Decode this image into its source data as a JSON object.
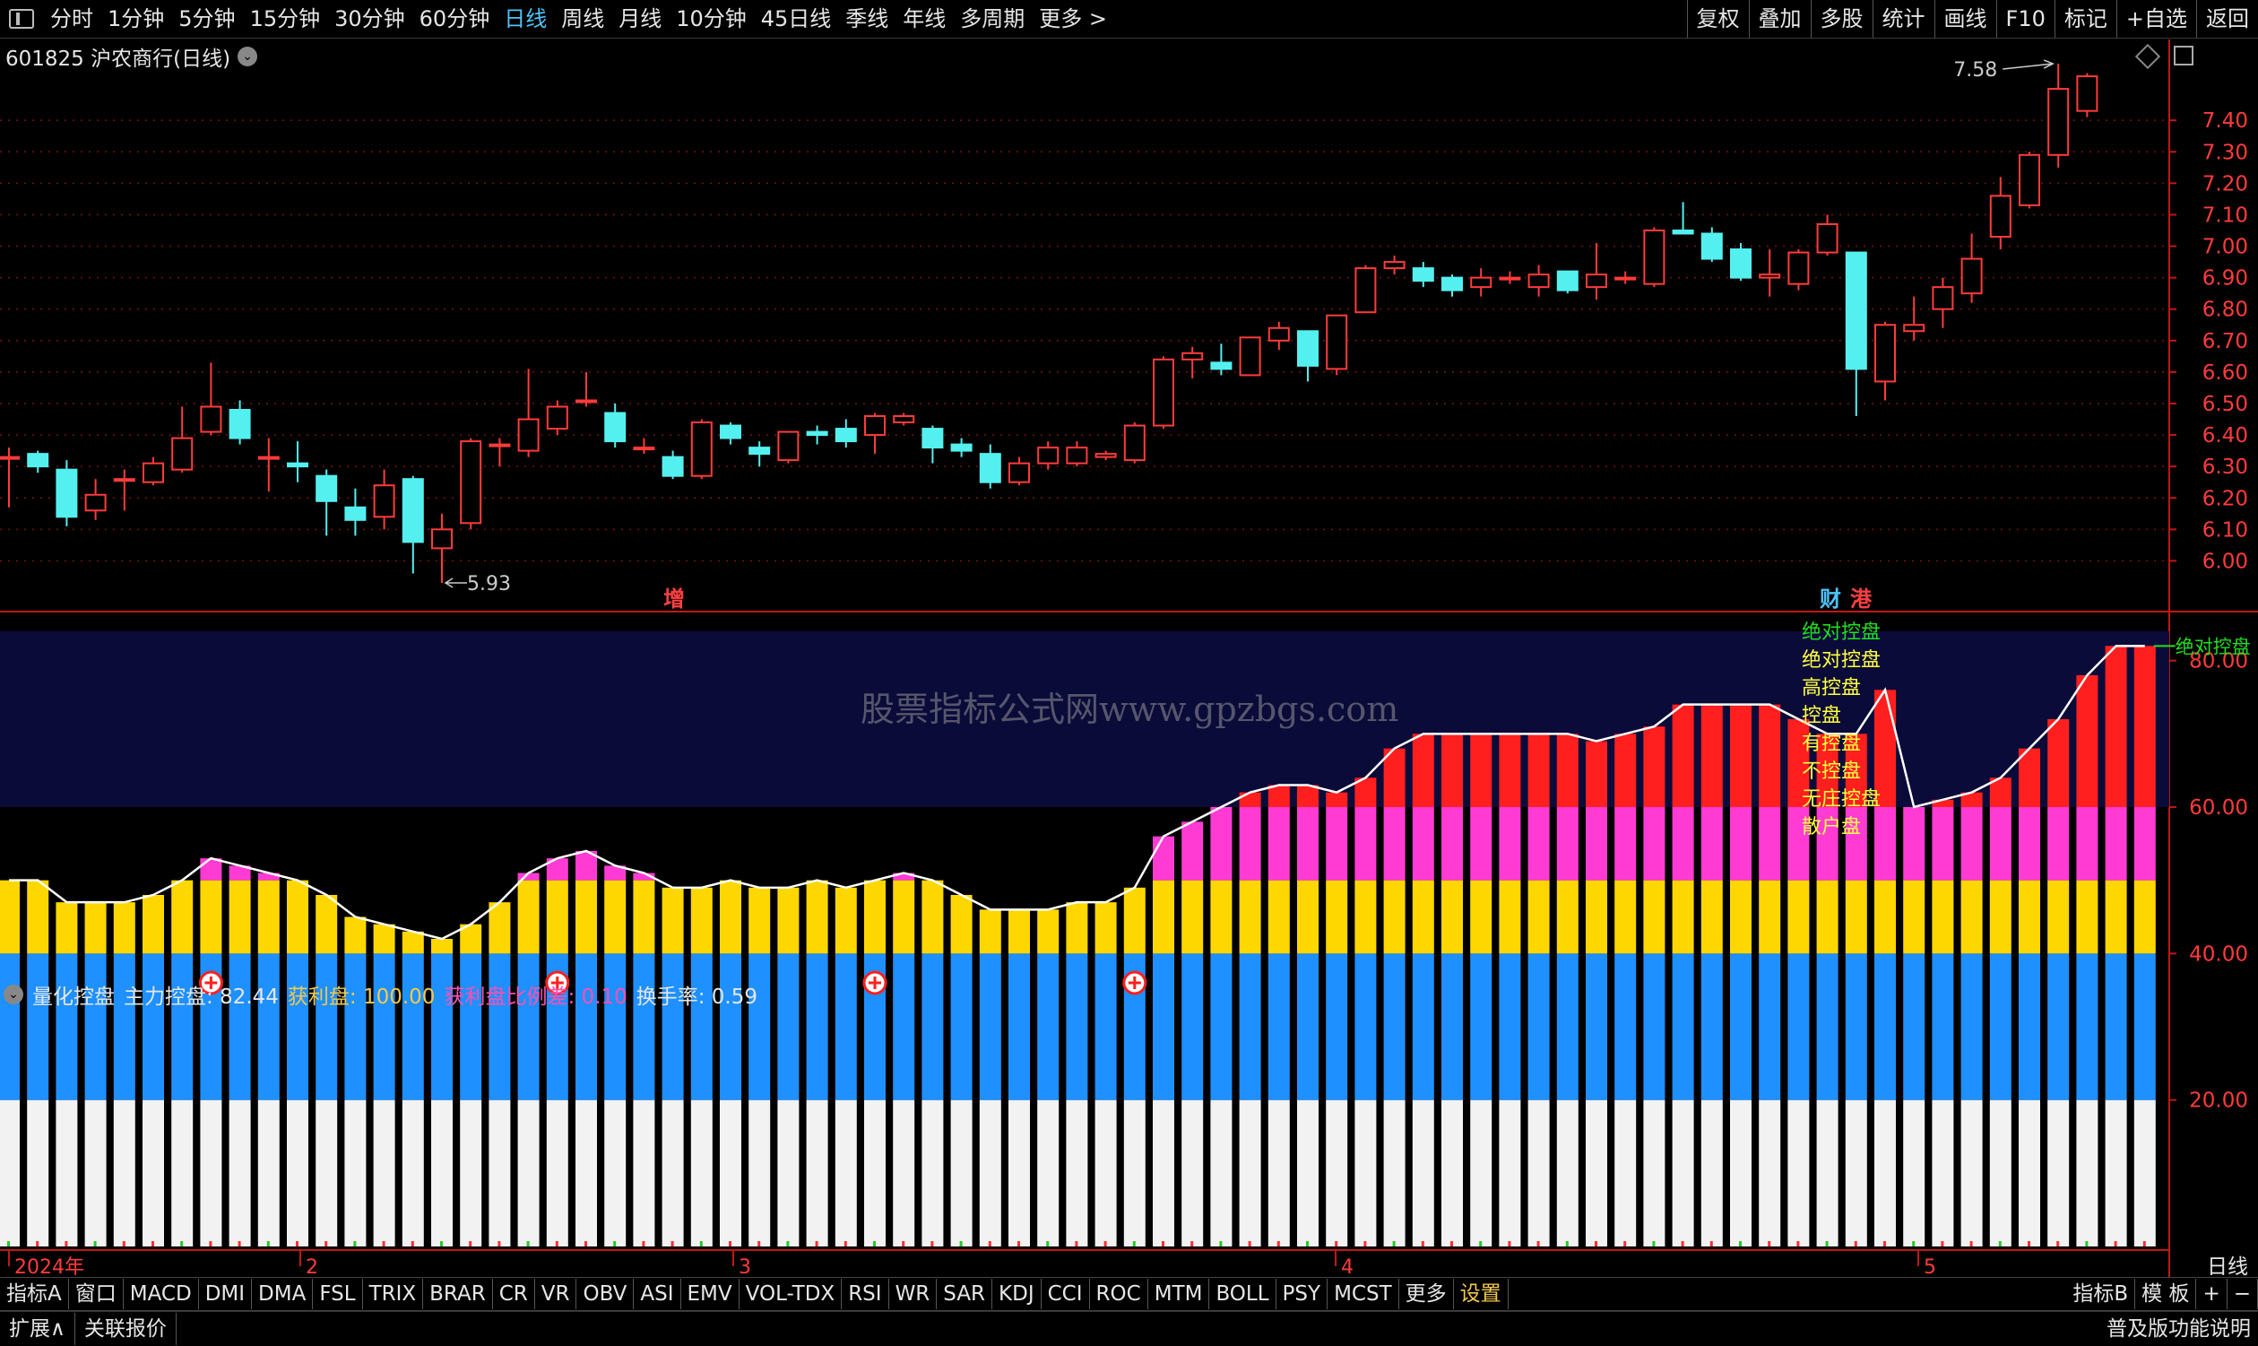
{
  "toolbar": {
    "periods": [
      "分时",
      "1分钟",
      "5分钟",
      "15分钟",
      "30分钟",
      "60分钟",
      "日线",
      "周线",
      "月线",
      "10分钟",
      "45日线",
      "季线",
      "年线",
      "多周期",
      "更多 >"
    ],
    "active_period": "日线",
    "right_buttons": [
      "复权",
      "叠加",
      "多股",
      "统计",
      "画线",
      "F10",
      "标记",
      "+自选",
      "返回"
    ]
  },
  "stock": {
    "title": "601825 沪农商行(日线)"
  },
  "watermark": "股票指标公式网www.gpzbgs.com",
  "chart_data": {
    "type": "candlestick",
    "y_ticks": [
      6.0,
      6.1,
      6.2,
      6.3,
      6.4,
      6.5,
      6.6,
      6.7,
      6.8,
      6.9,
      7.0,
      7.1,
      7.2,
      7.3,
      7.4
    ],
    "y_tick_labels": [
      "6.00",
      "6.10",
      "6.20",
      "6.30",
      "6.40",
      "6.50",
      "6.60",
      "6.70",
      "6.80",
      "6.90",
      "7.00",
      "7.10",
      "7.20",
      "7.30",
      "7.40"
    ],
    "ylim": [
      5.93,
      7.6
    ],
    "high_label": "7.58",
    "low_label": "5.93",
    "x_month_labels": [
      "2024年",
      "2",
      "3",
      "4",
      "5"
    ],
    "event_marks": [
      {
        "text": "增",
        "color": "#ff4040"
      },
      {
        "text": "财",
        "color": "#4fc3f7"
      },
      {
        "text": "港",
        "color": "#ff4040"
      }
    ],
    "candles": [
      [
        6.33,
        6.33,
        6.36,
        6.17
      ],
      [
        6.34,
        6.3,
        6.35,
        6.28
      ],
      [
        6.29,
        6.14,
        6.32,
        6.11
      ],
      [
        6.16,
        6.21,
        6.26,
        6.13
      ],
      [
        6.26,
        6.26,
        6.29,
        6.16
      ],
      [
        6.25,
        6.31,
        6.33,
        6.24
      ],
      [
        6.29,
        6.39,
        6.49,
        6.28
      ],
      [
        6.41,
        6.49,
        6.63,
        6.4
      ],
      [
        6.48,
        6.39,
        6.51,
        6.37
      ],
      [
        6.33,
        6.33,
        6.39,
        6.22
      ],
      [
        6.31,
        6.3,
        6.38,
        6.25
      ],
      [
        6.27,
        6.19,
        6.29,
        6.08
      ],
      [
        6.17,
        6.13,
        6.23,
        6.08
      ],
      [
        6.14,
        6.24,
        6.29,
        6.1
      ],
      [
        6.26,
        6.06,
        6.27,
        5.96
      ],
      [
        6.04,
        6.1,
        6.15,
        5.93
      ],
      [
        6.12,
        6.38,
        6.39,
        6.1
      ],
      [
        6.37,
        6.37,
        6.39,
        6.3
      ],
      [
        6.35,
        6.45,
        6.61,
        6.33
      ],
      [
        6.42,
        6.49,
        6.51,
        6.4
      ],
      [
        6.51,
        6.51,
        6.6,
        6.49
      ],
      [
        6.47,
        6.38,
        6.5,
        6.36
      ],
      [
        6.36,
        6.36,
        6.39,
        6.34
      ],
      [
        6.33,
        6.27,
        6.35,
        6.26
      ],
      [
        6.27,
        6.44,
        6.45,
        6.26
      ],
      [
        6.43,
        6.39,
        6.44,
        6.37
      ],
      [
        6.36,
        6.34,
        6.38,
        6.3
      ],
      [
        6.32,
        6.41,
        6.41,
        6.31
      ],
      [
        6.41,
        6.4,
        6.43,
        6.37
      ],
      [
        6.42,
        6.38,
        6.45,
        6.36
      ],
      [
        6.4,
        6.46,
        6.47,
        6.34
      ],
      [
        6.44,
        6.46,
        6.47,
        6.43
      ],
      [
        6.42,
        6.36,
        6.43,
        6.31
      ],
      [
        6.37,
        6.35,
        6.39,
        6.33
      ],
      [
        6.34,
        6.25,
        6.37,
        6.23
      ],
      [
        6.25,
        6.31,
        6.33,
        6.24
      ],
      [
        6.31,
        6.36,
        6.38,
        6.29
      ],
      [
        6.31,
        6.36,
        6.38,
        6.3
      ],
      [
        6.33,
        6.34,
        6.35,
        6.32
      ],
      [
        6.32,
        6.43,
        6.44,
        6.31
      ],
      [
        6.43,
        6.64,
        6.65,
        6.42
      ],
      [
        6.64,
        6.66,
        6.68,
        6.58
      ],
      [
        6.63,
        6.61,
        6.69,
        6.59
      ],
      [
        6.59,
        6.71,
        6.71,
        6.59
      ],
      [
        6.7,
        6.74,
        6.76,
        6.67
      ],
      [
        6.73,
        6.62,
        6.73,
        6.57
      ],
      [
        6.61,
        6.78,
        6.78,
        6.59
      ],
      [
        6.79,
        6.93,
        6.94,
        6.79
      ],
      [
        6.93,
        6.95,
        6.97,
        6.91
      ],
      [
        6.93,
        6.89,
        6.95,
        6.87
      ],
      [
        6.9,
        6.86,
        6.91,
        6.84
      ],
      [
        6.87,
        6.9,
        6.93,
        6.84
      ],
      [
        6.9,
        6.9,
        6.92,
        6.88
      ],
      [
        6.87,
        6.91,
        6.94,
        6.84
      ],
      [
        6.92,
        6.86,
        6.92,
        6.85
      ],
      [
        6.87,
        6.91,
        7.01,
        6.83
      ],
      [
        6.9,
        6.9,
        6.92,
        6.88
      ],
      [
        6.88,
        7.05,
        7.06,
        6.87
      ],
      [
        7.05,
        7.04,
        7.14,
        7.04
      ],
      [
        7.04,
        6.96,
        7.06,
        6.95
      ],
      [
        6.99,
        6.9,
        7.01,
        6.89
      ],
      [
        6.9,
        6.91,
        6.99,
        6.84
      ],
      [
        6.88,
        6.98,
        6.99,
        6.86
      ],
      [
        6.98,
        7.07,
        7.1,
        6.97
      ],
      [
        6.98,
        6.61,
        6.98,
        6.46
      ],
      [
        6.57,
        6.75,
        6.76,
        6.51
      ],
      [
        6.73,
        6.75,
        6.84,
        6.7
      ],
      [
        6.8,
        6.87,
        6.9,
        6.74
      ],
      [
        6.85,
        6.96,
        7.04,
        6.82
      ],
      [
        7.03,
        7.16,
        7.22,
        6.99
      ],
      [
        7.13,
        7.29,
        7.3,
        7.12
      ],
      [
        7.29,
        7.5,
        7.58,
        7.25
      ],
      [
        7.43,
        7.54,
        7.55,
        7.41
      ]
    ]
  },
  "indicator": {
    "name": "量化控盘",
    "items": [
      {
        "label": "主力控盘:",
        "value": "82.44",
        "color": "#e6e6e6"
      },
      {
        "label": "获利盘:",
        "value": "100.00",
        "color": "#f2c94c"
      },
      {
        "label": "获利盘比例差:",
        "value": "0.10",
        "color": "#ff4fb0"
      },
      {
        "label": "换手率:",
        "value": "0.59",
        "color": "#e6e6e6"
      }
    ],
    "y_ticks": [
      20,
      40,
      60,
      80
    ],
    "y_tick_labels": [
      "20.00",
      "40.00",
      "60.00",
      "80.00"
    ],
    "ylim": [
      0,
      84
    ],
    "legend": [
      "绝对控盘",
      "绝对控盘",
      "高控盘",
      "控盘",
      "有控盘",
      "不控盘",
      "无庄控盘",
      "散户盘"
    ],
    "line_label": "绝对控盘",
    "values": [
      50,
      50,
      47,
      47,
      47,
      48,
      50,
      53,
      52,
      51,
      50,
      48,
      45,
      44,
      43,
      42,
      44,
      47,
      51,
      53,
      54,
      52,
      51,
      49,
      49,
      50,
      49,
      49,
      50,
      49,
      50,
      51,
      50,
      48,
      46,
      46,
      46,
      47,
      47,
      49,
      56,
      58,
      60,
      62,
      63,
      63,
      62,
      64,
      68,
      70,
      70,
      70,
      70,
      70,
      70,
      69,
      70,
      71,
      74,
      74,
      74,
      74,
      72,
      70,
      70,
      76,
      60,
      61,
      62,
      64,
      68,
      72,
      78,
      82,
      82
    ]
  },
  "indicator_tabs": [
    "指标A",
    "窗口",
    "MACD",
    "DMI",
    "DMA",
    "FSL",
    "TRIX",
    "BRAR",
    "CR",
    "VR",
    "OBV",
    "ASI",
    "EMV",
    "VOL-TDX",
    "RSI",
    "WR",
    "SAR",
    "KDJ",
    "CCI",
    "ROC",
    "MTM",
    "BOLL",
    "PSY",
    "MCST",
    "更多",
    "设置"
  ],
  "indicator_tabs_right": [
    "指标B",
    "模 板",
    "+",
    "−"
  ],
  "period_label": "日线",
  "statusbar": {
    "left": [
      "扩展∧",
      "关联报价"
    ],
    "right": "普及版功能说明"
  },
  "colors": {
    "up": "#ff3b3b",
    "down": "#54f0f0",
    "grid": "#7a1010",
    "axis": "#c01818"
  }
}
